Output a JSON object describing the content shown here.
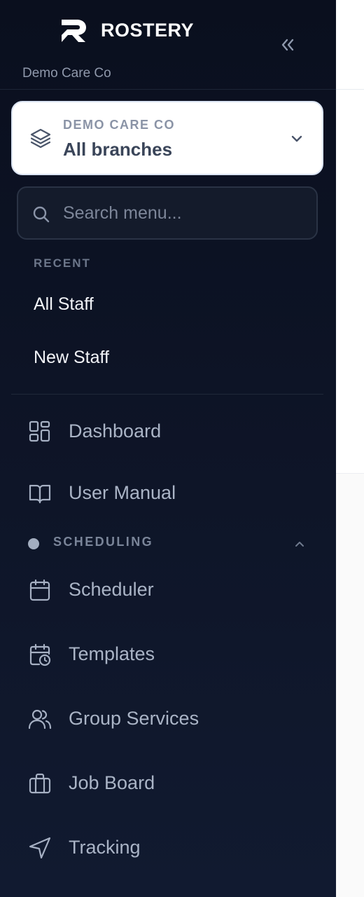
{
  "brand": {
    "name": "ROSTERY",
    "org_name": "Demo Care Co",
    "collapse_icon": "chevrons-left-icon"
  },
  "branch_selector": {
    "subtitle": "DEMO CARE CO",
    "value": "All branches",
    "icon": "layers-icon",
    "chevron": "chevron-down-icon"
  },
  "search": {
    "placeholder": "Search menu...",
    "value": ""
  },
  "recent": {
    "heading": "RECENT",
    "items": [
      "All Staff",
      "New Staff"
    ]
  },
  "nav": {
    "items": [
      {
        "label": "Dashboard",
        "icon": "dashboard-grid-icon"
      },
      {
        "label": "User Manual",
        "icon": "book-open-icon"
      }
    ],
    "sections": [
      {
        "label": "SCHEDULING",
        "expanded": true,
        "items": [
          {
            "label": "Scheduler",
            "icon": "calendar-icon"
          },
          {
            "label": "Templates",
            "icon": "calendar-clock-icon"
          },
          {
            "label": "Group Services",
            "icon": "users-icon"
          },
          {
            "label": "Job Board",
            "icon": "briefcase-icon"
          },
          {
            "label": "Tracking",
            "icon": "navigation-icon"
          }
        ]
      }
    ]
  },
  "colors": {
    "sidebar_bg": "#0a0f1e",
    "nav_text": "#aab4c6",
    "recent_text": "#f2f4f8",
    "card_bg": "#ffffff"
  }
}
